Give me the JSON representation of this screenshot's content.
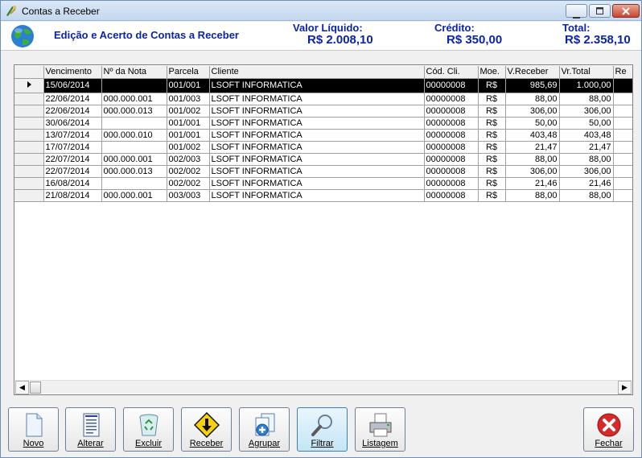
{
  "window": {
    "title": "Contas a Receber"
  },
  "header": {
    "title": "Edição e Acerto de Contas a Receber",
    "valor_liquido_label": "Valor Líquido:",
    "valor_liquido": "R$ 2.008,10",
    "credito_label": "Crédito:",
    "credito": "R$ 350,00",
    "total_label": "Total:",
    "total": "R$ 2.358,10"
  },
  "grid": {
    "columns": [
      "Vencimento",
      "Nº da Nota",
      "Parcela",
      "Cliente",
      "Cód. Cli.",
      "Moe.",
      "V.Receber",
      "Vr.Total",
      "Re"
    ],
    "rows": [
      [
        "15/06/2014",
        "",
        "001/001",
        "LSOFT INFORMATICA",
        "00000008",
        "R$",
        "985,69",
        "1.000,00",
        ""
      ],
      [
        "22/06/2014",
        "000.000.001",
        "001/003",
        "LSOFT INFORMATICA",
        "00000008",
        "R$",
        "88,00",
        "88,00",
        ""
      ],
      [
        "22/06/2014",
        "000.000.013",
        "001/002",
        "LSOFT INFORMATICA",
        "00000008",
        "R$",
        "306,00",
        "306,00",
        ""
      ],
      [
        "30/06/2014",
        "",
        "001/001",
        "LSOFT INFORMATICA",
        "00000008",
        "R$",
        "50,00",
        "50,00",
        ""
      ],
      [
        "13/07/2014",
        "000.000.010",
        "001/001",
        "LSOFT INFORMATICA",
        "00000008",
        "R$",
        "403,48",
        "403,48",
        ""
      ],
      [
        "17/07/2014",
        "",
        "001/002",
        "LSOFT INFORMATICA",
        "00000008",
        "R$",
        "21,47",
        "21,47",
        ""
      ],
      [
        "22/07/2014",
        "000.000.001",
        "002/003",
        "LSOFT INFORMATICA",
        "00000008",
        "R$",
        "88,00",
        "88,00",
        ""
      ],
      [
        "22/07/2014",
        "000.000.013",
        "002/002",
        "LSOFT INFORMATICA",
        "00000008",
        "R$",
        "306,00",
        "306,00",
        ""
      ],
      [
        "16/08/2014",
        "",
        "002/002",
        "LSOFT INFORMATICA",
        "00000008",
        "R$",
        "21,46",
        "21,46",
        ""
      ],
      [
        "21/08/2014",
        "000.000.001",
        "003/003",
        "LSOFT INFORMATICA",
        "00000008",
        "R$",
        "88,00",
        "88,00",
        ""
      ]
    ],
    "selected_row": 0
  },
  "toolbar": {
    "novo": "Novo",
    "alterar": "Alterar",
    "excluir": "Excluir",
    "receber": "Receber",
    "agrupar": "Agrupar",
    "filtrar": "Filtrar",
    "listagem": "Listagem",
    "fechar": "Fechar"
  },
  "icons": {
    "novo": "blank-document-icon",
    "alterar": "edit-document-icon",
    "excluir": "recycle-bin-icon",
    "receber": "yellow-down-arrow-icon",
    "agrupar": "add-documents-icon",
    "filtrar": "magnifier-icon",
    "listagem": "printer-icon",
    "fechar": "red-x-icon"
  },
  "colors": {
    "accent": "#0b24a8",
    "selection": "#000000",
    "close": "#d8282a"
  }
}
